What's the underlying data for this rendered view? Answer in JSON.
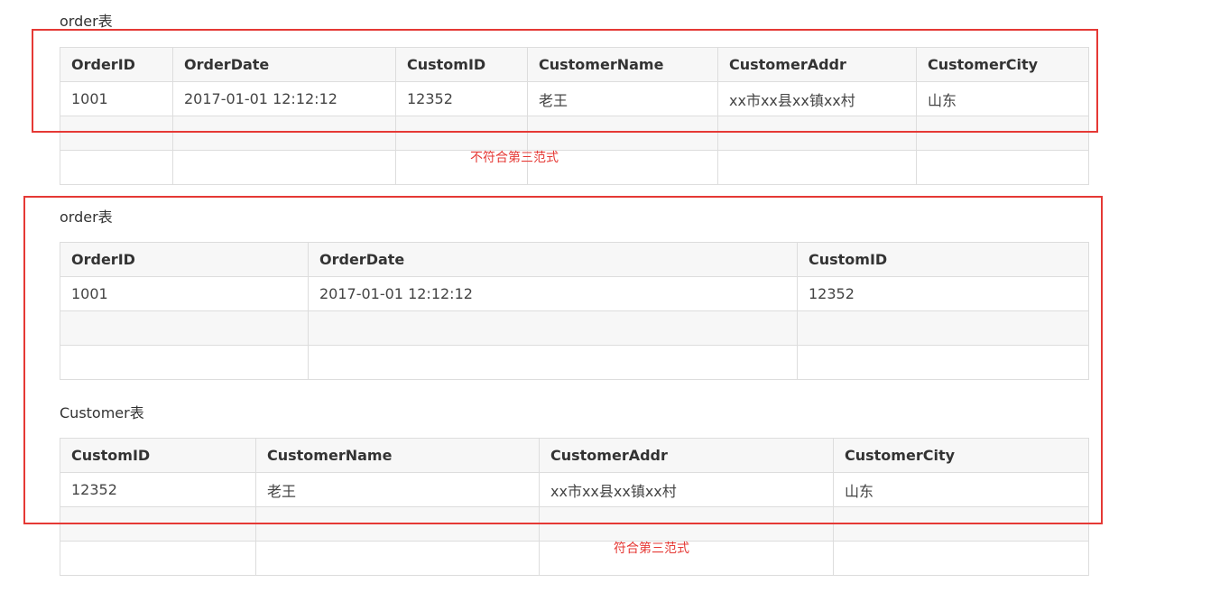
{
  "section1": {
    "caption": "order表",
    "headers": [
      "OrderID",
      "OrderDate",
      "CustomID",
      "CustomerName",
      "CustomerAddr",
      "CustomerCity"
    ],
    "row": [
      "1001",
      "2017-01-01 12:12:12",
      "12352",
      "老王",
      "xx市xx县xx镇xx村",
      "山东"
    ],
    "note": "不符合第三范式"
  },
  "section2": {
    "order_caption": "order表",
    "order_headers": [
      "OrderID",
      "OrderDate",
      "CustomID"
    ],
    "order_row": [
      "1001",
      "2017-01-01 12:12:12",
      "12352"
    ],
    "customer_caption": "Customer表",
    "customer_headers": [
      "CustomID",
      "CustomerName",
      "CustomerAddr",
      "CustomerCity"
    ],
    "customer_row": [
      "12352",
      "老王",
      "xx市xx县xx镇xx村",
      "山东"
    ],
    "note": "符合第三范式"
  },
  "colors": {
    "annotation": "#e53935",
    "header_bg": "#f7f7f7",
    "border": "#dddddd"
  }
}
